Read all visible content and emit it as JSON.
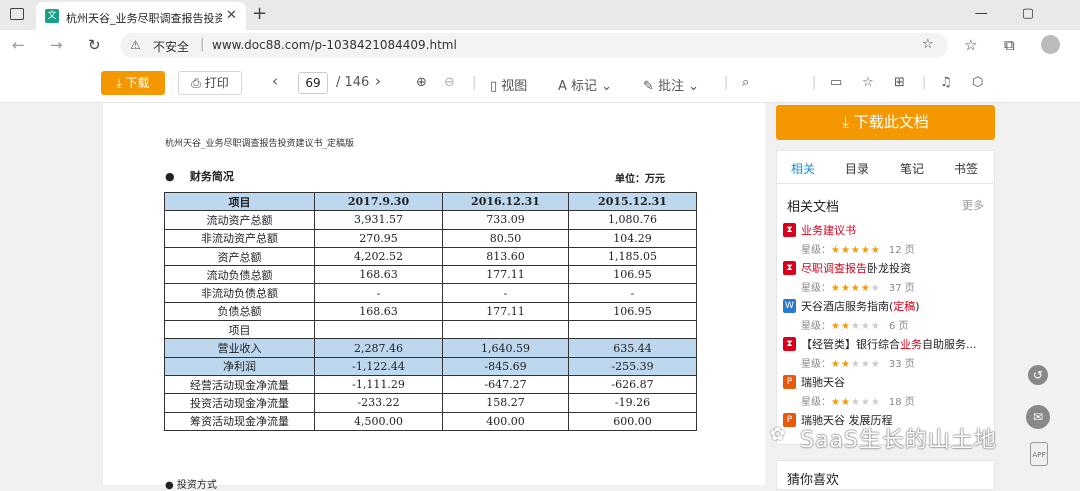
{
  "browser": {
    "tab_title": "杭州天谷_业务尽职调查报告投资",
    "tab_favicon": "文",
    "security_label": "不安全",
    "url": "www.doc88.com/p-1038421084409.html"
  },
  "toolbar": {
    "download_label": "下载",
    "print_label": "打印",
    "current_page": "69",
    "total_pages": "/ 146",
    "view_label": "视图",
    "mark_label": "标记",
    "annotate_label": "批注"
  },
  "document": {
    "running_head": "杭州天谷_业务尽职调查报告投资建议书_定稿版",
    "section_title": "财务简况",
    "unit": "单位：万元",
    "table": {
      "headers": [
        "项目",
        "2017.9.30",
        "2016.12.31",
        "2015.12.31"
      ],
      "rows": [
        {
          "cells": [
            "流动资产总额",
            "3,931.57",
            "733.09",
            "1,080.76"
          ],
          "highlight": false
        },
        {
          "cells": [
            "非流动资产总额",
            "270.95",
            "80.50",
            "104.29"
          ],
          "highlight": false
        },
        {
          "cells": [
            "资产总额",
            "4,202.52",
            "813.60",
            "1,185.05"
          ],
          "highlight": false
        },
        {
          "cells": [
            "流动负债总额",
            "168.63",
            "177.11",
            "106.95"
          ],
          "highlight": false
        },
        {
          "cells": [
            "非流动负债总额",
            "-",
            "-",
            "-"
          ],
          "highlight": false
        },
        {
          "cells": [
            "负债总额",
            "168.63",
            "177.11",
            "106.95"
          ],
          "highlight": false
        },
        {
          "cells": [
            "项目",
            "",
            "",
            ""
          ],
          "highlight": false
        },
        {
          "cells": [
            "营业收入",
            "2,287.46",
            "1,640.59",
            "635.44"
          ],
          "highlight": true
        },
        {
          "cells": [
            "净利润",
            "-1,122.44",
            "-845.69",
            "-255.39"
          ],
          "highlight": true
        },
        {
          "cells": [
            "经营活动现金净流量",
            "-1,111.29",
            "-647.27",
            "-626.87"
          ],
          "highlight": false
        },
        {
          "cells": [
            "投资活动现金净流量",
            "-233.22",
            "158.27",
            "-19.26"
          ],
          "highlight": false
        },
        {
          "cells": [
            "筹资活动现金净流量",
            "4,500.00",
            "400.00",
            "600.00"
          ],
          "highlight": false
        }
      ]
    },
    "bottom_heading": "● 投资方式"
  },
  "sidebar": {
    "download_doc_label": "下载此文档",
    "tabs": [
      "相关",
      "目录",
      "笔记",
      "书签"
    ],
    "related_title": "相关文档",
    "more_label": "更多",
    "rating_label": "星级：",
    "items": [
      {
        "title_pre": "",
        "title_hl": "业务建议书",
        "title_post": "",
        "icon": "pdf",
        "stars": 5,
        "pages": "12 页"
      },
      {
        "title_pre": "",
        "title_hl": "尽职调查报告",
        "title_post": "卧龙投资",
        "icon": "pdf",
        "stars": 4,
        "pages": "37 页"
      },
      {
        "title_pre": "天谷酒店服务指南(",
        "title_hl": "定稿",
        "title_post": ")",
        "icon": "word",
        "stars": 2,
        "pages": "6 页"
      },
      {
        "title_pre": "【经管类】银行综合",
        "title_hl": "业务",
        "title_post": "自助服务...",
        "icon": "pdf",
        "stars": 2,
        "pages": "33 页"
      },
      {
        "title_pre": "瑞驰天谷",
        "title_hl": "",
        "title_post": "",
        "icon": "ppt",
        "stars": 2,
        "pages": "18 页"
      },
      {
        "title_pre": "瑞驰天谷 发展历程",
        "title_hl": "",
        "title_post": "",
        "icon": "ppt",
        "stars": 0,
        "pages": ""
      }
    ],
    "guess_label": "猜你喜欢"
  },
  "watermark": "SaaS生长的山土地",
  "colors": {
    "accent": "#f39800",
    "link": "#1a8fd6",
    "table_header": "#bdd7ee",
    "highlight_red": "#d9001b"
  }
}
